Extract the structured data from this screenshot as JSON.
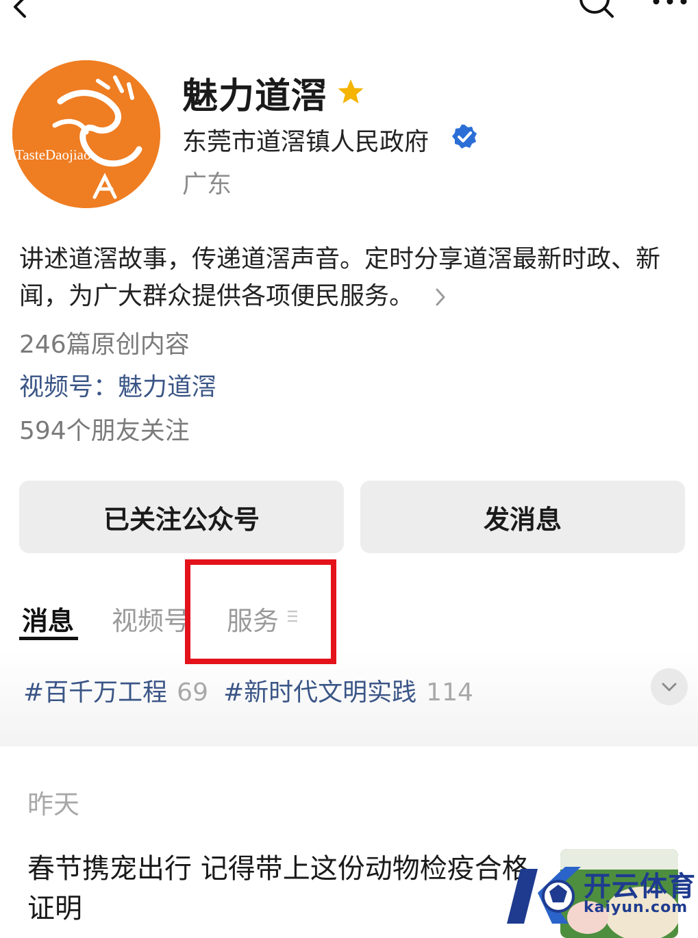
{
  "profile": {
    "name": "魅力道滘",
    "organization": "东莞市道滘镇人民政府",
    "region": "广东",
    "description": "讲述道滘故事，传递道滘声音。定时分享道滘最新时政、新闻，为广大群众提供各项便民服务。",
    "articles": "246篇原创内容",
    "channel": "视频号：魅力道滘",
    "friends": "594个朋友关注",
    "star_color": "#f4b400",
    "verified_color": "#2b6fd6"
  },
  "avatar": {
    "background": "#ef7d22",
    "logo_text": "TasteDaojiao"
  },
  "buttons": {
    "follow": "已关注公众号",
    "message": "发消息"
  },
  "tabs": [
    {
      "label": "消息",
      "active": true
    },
    {
      "label": "视频号",
      "active": false
    },
    {
      "label": "服务",
      "active": false
    }
  ],
  "tags": [
    {
      "label": "#百千万工程",
      "count": "69"
    },
    {
      "label": "#新时代文明实践",
      "count": "114"
    }
  ],
  "feed": {
    "date": "昨天",
    "title": "春节携宠出行 记得带上这份动物检疫合格证明"
  },
  "watermark": {
    "name": "开云体育",
    "url": "kaiyun.com"
  },
  "icons": {
    "back": "back-arrow-icon",
    "search": "search-icon",
    "more": "more-dots-icon",
    "star": "star-icon",
    "verified": "verified-badge-icon",
    "chevron": "chevron-right-icon",
    "expand": "chevron-down-icon",
    "menu": "menu-lines-icon"
  }
}
